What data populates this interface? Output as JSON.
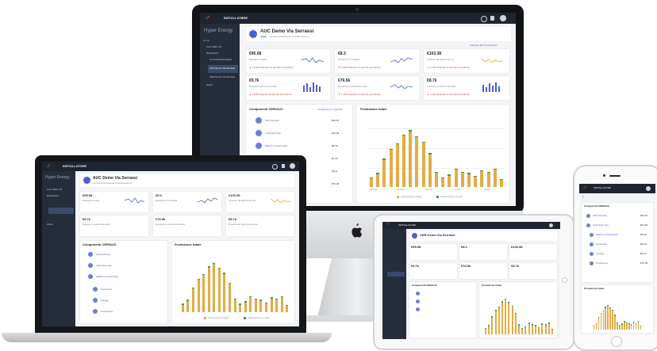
{
  "app": {
    "brand": "Hyper Energy",
    "menu_title": "INSTALLATORE",
    "user_label": "Hyper Energy Admin"
  },
  "page": {
    "title": "AUC Demo Via Serrassi",
    "badge": "RCE",
    "subtitle": "Componenti Energie di autoconsumo",
    "link": "Sabrella dati Ora 10 giorni"
  },
  "tablet_page": {
    "title": "CER Demo Via Serrassi"
  },
  "sidebar": {
    "items": [
      {
        "label": "Home"
      },
      {
        "label": "Livio CER 1ml"
      },
      {
        "label": "Dashboard"
      },
      {
        "label": "Comunità Energetica"
      },
      {
        "label": "AUC Demo Via Serrassi"
      },
      {
        "label": "CER Demo Via Serrassi"
      },
      {
        "label": "Utenti"
      }
    ]
  },
  "kpis": [
    {
      "value": "€95.08",
      "label": "Risparmio totale",
      "delta": "▲ 12.04% Rispetto al periodo precedente",
      "color": "#4a5fd3"
    },
    {
      "value": "€8.3",
      "label": "Risparmio in bolletta",
      "delta": "▼ 3.26% Rispetto al periodo precedente",
      "color": "#4a5fd3"
    },
    {
      "value": "€103.38",
      "label": "Incentivi da autoconsumo",
      "delta": "▲ 4.73% Rispetto al periodo precedente",
      "color": "#e0a93f"
    },
    {
      "value": "€9.7k",
      "label": "Risparmio autoconsumato",
      "delta": "▲ 6.09% Rispetto al periodo precedente",
      "color": "#4a5fd3"
    },
    {
      "value": "€76.5k",
      "label": "Quotazione autoconsumata",
      "delta": "▼ 2.18% Rispetto al periodo precedente",
      "color": "#4a5fd3"
    },
    {
      "value": "€8.7k",
      "label": "Produzione autoconsumata",
      "delta": "▲ 1.15% Rispetto al periodo precedente",
      "color": "#4a5fd3"
    }
  ],
  "components": {
    "title": "Componenti CER/AUC",
    "link": "Visualizza per seguente",
    "rows": [
      {
        "label": "UPS Pescata",
        "value": "€32.97"
      },
      {
        "label": "Casa Domingo",
        "value": "€21.60"
      },
      {
        "label": "Edificio condominiale",
        "value": "€8.46"
      },
      {
        "label": "Ascensore",
        "value": "€4.20"
      },
      {
        "label": "Garage",
        "value": "€3.11"
      },
      {
        "label": "Produzione",
        "value": "€74.46"
      }
    ]
  },
  "production": {
    "title": "Produzione totale",
    "legend": [
      "Autoconsumo totale",
      "Autoconsumo in rete"
    ],
    "xticks": [
      "22 Set",
      "24 Set",
      "26 Set",
      "1 Ott",
      "3 Ott"
    ]
  },
  "chart_data": {
    "type": "bar",
    "title": "Produzione totale",
    "series": [
      {
        "name": "Autoconsumo totale",
        "values": [
          12,
          18,
          38,
          52,
          60,
          72,
          78,
          70,
          62,
          46,
          20,
          12,
          16,
          24,
          20,
          18,
          14,
          22,
          20,
          24,
          10
        ]
      },
      {
        "name": "Autoconsumo in rete",
        "values": [
          4,
          6,
          8,
          10,
          12,
          14,
          16,
          12,
          10,
          8,
          5,
          3,
          5,
          6,
          5,
          5,
          4,
          6,
          5,
          6,
          3
        ]
      }
    ],
    "ylim": [
      0,
      100
    ],
    "legend_position": "bottom"
  },
  "colors": {
    "accent": "#e86b2a",
    "bar": "#e3ac45",
    "bar_secondary": "#3f9a5b",
    "sidebar": "#262d3a",
    "topbar": "#1f2530"
  }
}
